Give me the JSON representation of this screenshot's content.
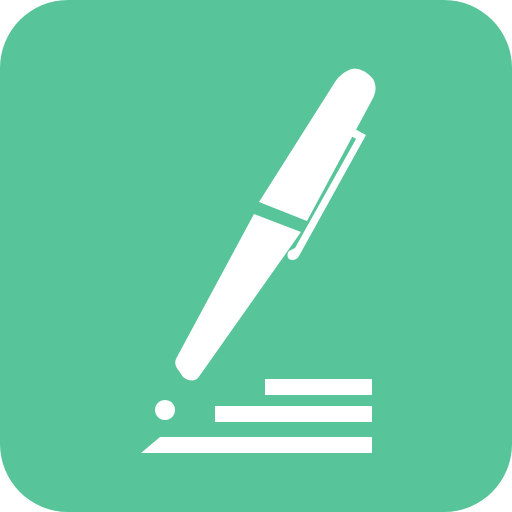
{
  "icon": {
    "name": "pen-writing-icon",
    "colors": {
      "background": "#57C49A",
      "glyph": "#FFFFFF"
    }
  }
}
